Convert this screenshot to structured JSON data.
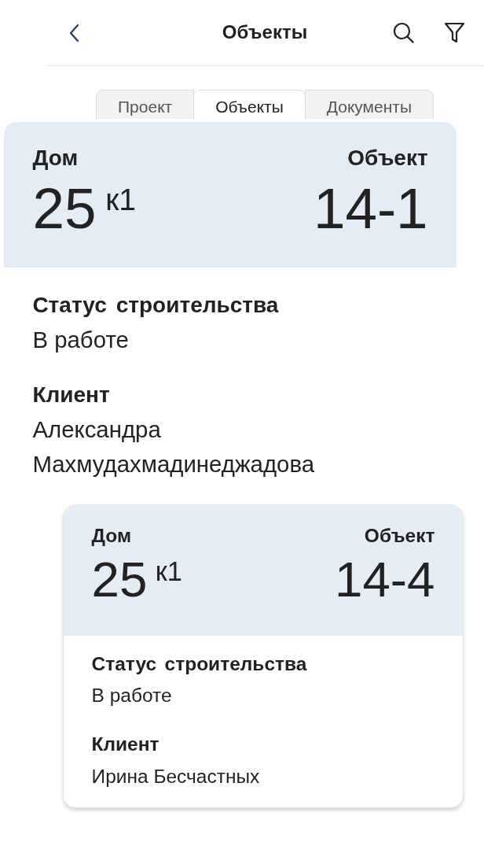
{
  "header": {
    "title": "Объекты"
  },
  "tabs": [
    {
      "label": "Проект",
      "selected": false
    },
    {
      "label": "Объекты",
      "selected": true
    },
    {
      "label": "Документы",
      "selected": false
    }
  ],
  "objects": [
    {
      "expanded": true,
      "house_label": "Дом",
      "house_number": "25",
      "house_building": "к1",
      "object_label": "Объект",
      "object_number": "14-1",
      "fields": [
        {
          "label": "Статус строительства",
          "value": "В работе"
        },
        {
          "label": "Клиент",
          "value": "Александра Махмудахмадинеджадова"
        }
      ]
    },
    {
      "expanded": false,
      "house_label": "Дом",
      "house_number": "25",
      "house_building": "к1",
      "object_label": "Объект",
      "object_number": "14-4",
      "fields": [
        {
          "label": "Статус строительства",
          "value": "В работе"
        },
        {
          "label": "Клиент",
          "value": "Ирина Бесчастных"
        }
      ]
    }
  ]
}
